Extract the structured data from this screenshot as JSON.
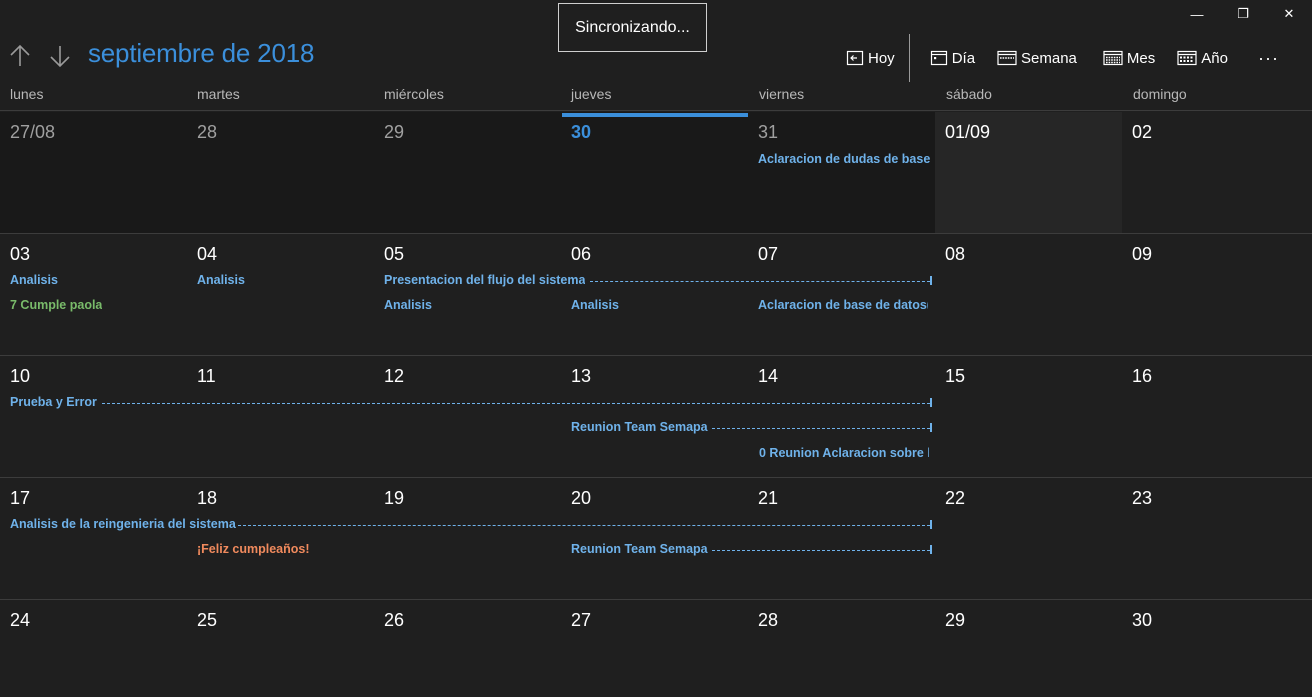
{
  "window": {
    "min_glyph": "—",
    "max_glyph": "❐",
    "close_glyph": "✕"
  },
  "sync": {
    "label": "Sincronizando..."
  },
  "header": {
    "title": "septiembre de 2018"
  },
  "toolbar": {
    "today": "Hoy",
    "day": "Día",
    "week": "Semana",
    "month": "Mes",
    "year": "Año",
    "more": "···"
  },
  "weekdays": [
    "lunes",
    "martes",
    "miércoles",
    "jueves",
    "viernes",
    "sábado",
    "domingo"
  ],
  "weeks": [
    {
      "days": [
        "27/08",
        "28",
        "29",
        "30",
        "31",
        "01/09",
        "02"
      ]
    },
    {
      "days": [
        "03",
        "04",
        "05",
        "06",
        "07",
        "08",
        "09"
      ]
    },
    {
      "days": [
        "10",
        "11",
        "12",
        "13",
        "14",
        "15",
        "16"
      ]
    },
    {
      "days": [
        "17",
        "18",
        "19",
        "20",
        "21",
        "22",
        "23"
      ]
    },
    {
      "days": [
        "24",
        "25",
        "26",
        "27",
        "28",
        "29",
        "30"
      ]
    }
  ],
  "events": {
    "w0_fri": "Aclaracion de dudas de base",
    "w1_mon_a": "Analisis",
    "w1_mon_b": "7 Cumple paola",
    "w1_tue": "Analisis",
    "w1_wed_span": "Presentacion del flujo del sistema",
    "w1_wed_b": "Analisis",
    "w1_thu": "Analisis",
    "w1_fri": "Aclaracion de base de datos(",
    "w2_span1": "Prueba y Error",
    "w2_span2": "Reunion Team Semapa",
    "w2_fri": "0 Reunion Aclaracion sobre l",
    "w3_span1": "Analisis de la reingenieria del sistema",
    "w3_tue": "¡Feliz cumpleaños!",
    "w3_span2": "Reunion Team Semapa"
  },
  "colors": {
    "accent": "#3b8fdb",
    "event_blue": "#6fb2ea",
    "event_green": "#79bb6a",
    "event_orange": "#f08a5d",
    "background": "#1f1f1f"
  }
}
